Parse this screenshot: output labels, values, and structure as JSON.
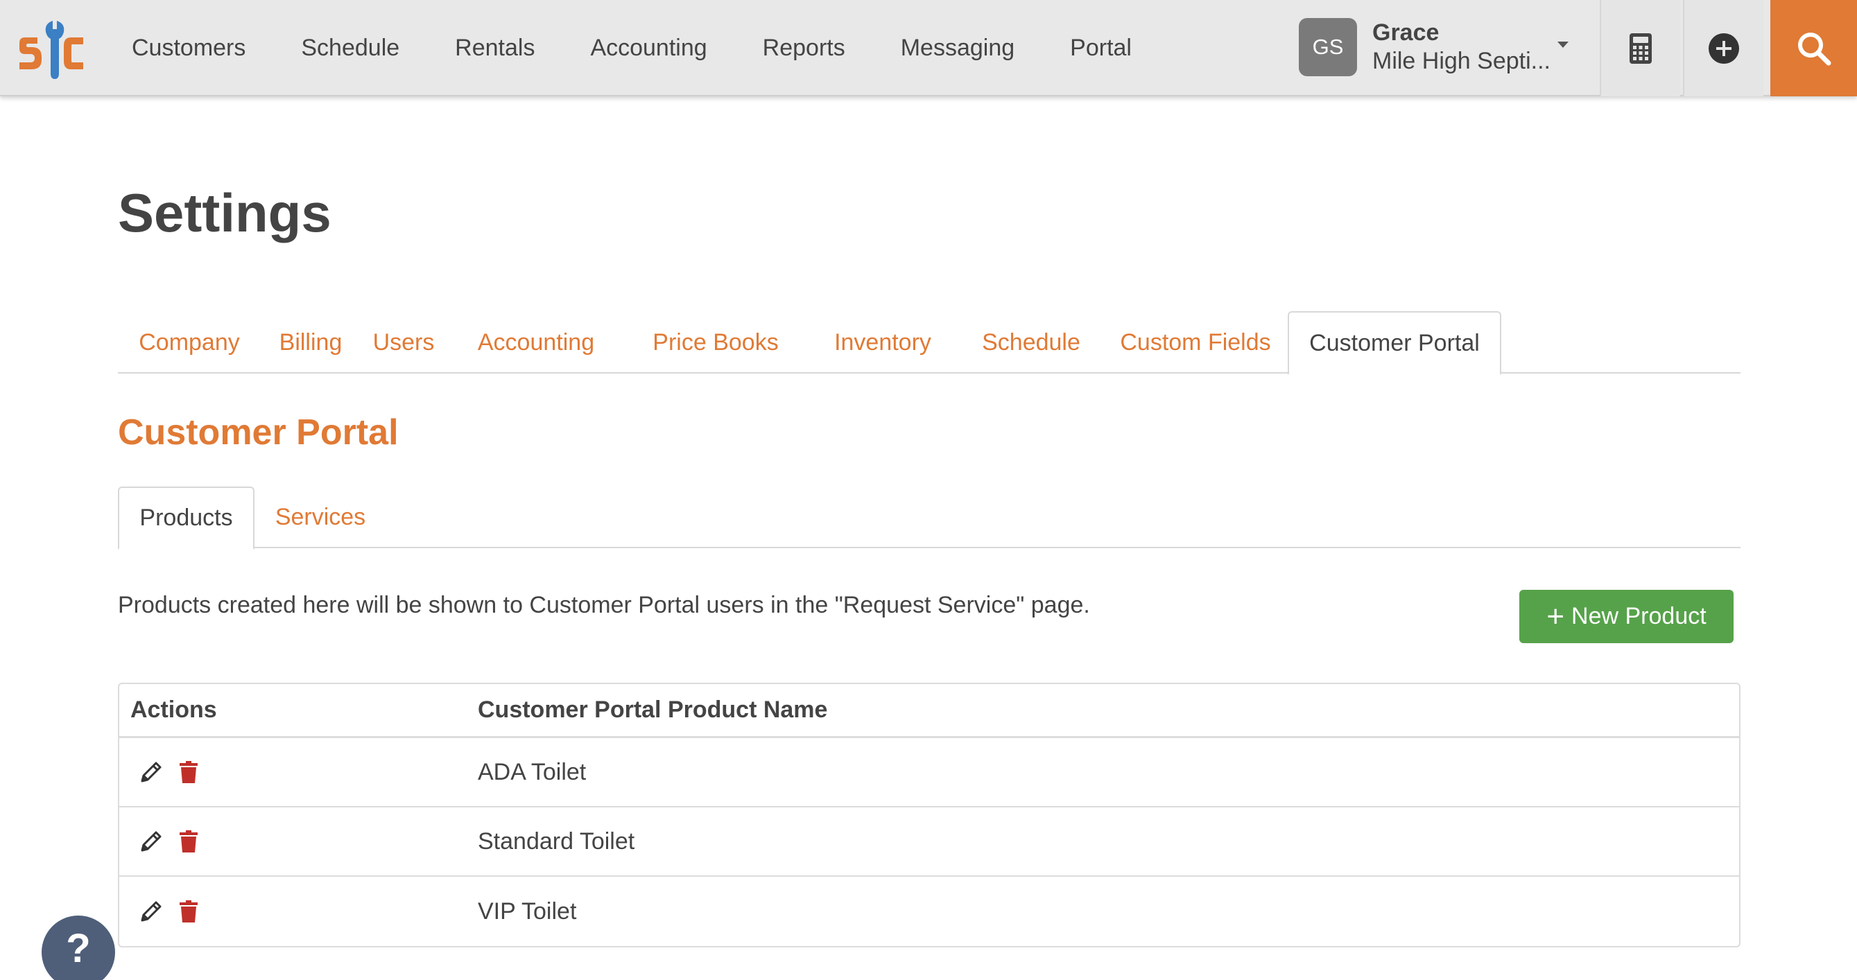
{
  "app": {
    "logo_text": "s/c"
  },
  "topnav": {
    "items": [
      "Customers",
      "Schedule",
      "Rentals",
      "Accounting",
      "Reports",
      "Messaging",
      "Portal"
    ]
  },
  "user": {
    "initials": "GS",
    "name": "Grace",
    "org": "Mile High Septi..."
  },
  "toolbar_icons": [
    "calculator-icon",
    "plus-circle-icon",
    "search-icon"
  ],
  "page": {
    "title": "Settings"
  },
  "settings_tabs": [
    {
      "label": "Company",
      "active": false
    },
    {
      "label": "Billing",
      "active": false
    },
    {
      "label": "Users",
      "active": false
    },
    {
      "label": "Accounting",
      "active": false
    },
    {
      "label": "Price Books",
      "active": false
    },
    {
      "label": "Inventory",
      "active": false
    },
    {
      "label": "Schedule",
      "active": false
    },
    {
      "label": "Custom Fields",
      "active": false
    },
    {
      "label": "Customer Portal",
      "active": true
    }
  ],
  "section": {
    "title": "Customer Portal"
  },
  "sub_tabs": [
    {
      "label": "Products",
      "active": true
    },
    {
      "label": "Services",
      "active": false
    }
  ],
  "description": "Products created here will be shown to Customer Portal users in the \"Request Service\" page.",
  "new_product_button": {
    "label": "New Product"
  },
  "table": {
    "columns": [
      "Actions",
      "Customer Portal Product Name"
    ],
    "rows": [
      {
        "name": "ADA Toilet"
      },
      {
        "name": "Standard Toilet"
      },
      {
        "name": "VIP Toilet"
      }
    ]
  },
  "help_button": {
    "label": "?"
  },
  "colors": {
    "accent": "#e07a35",
    "success": "#56a24a",
    "delete": "#c0302a",
    "help": "#4f5f7a"
  }
}
